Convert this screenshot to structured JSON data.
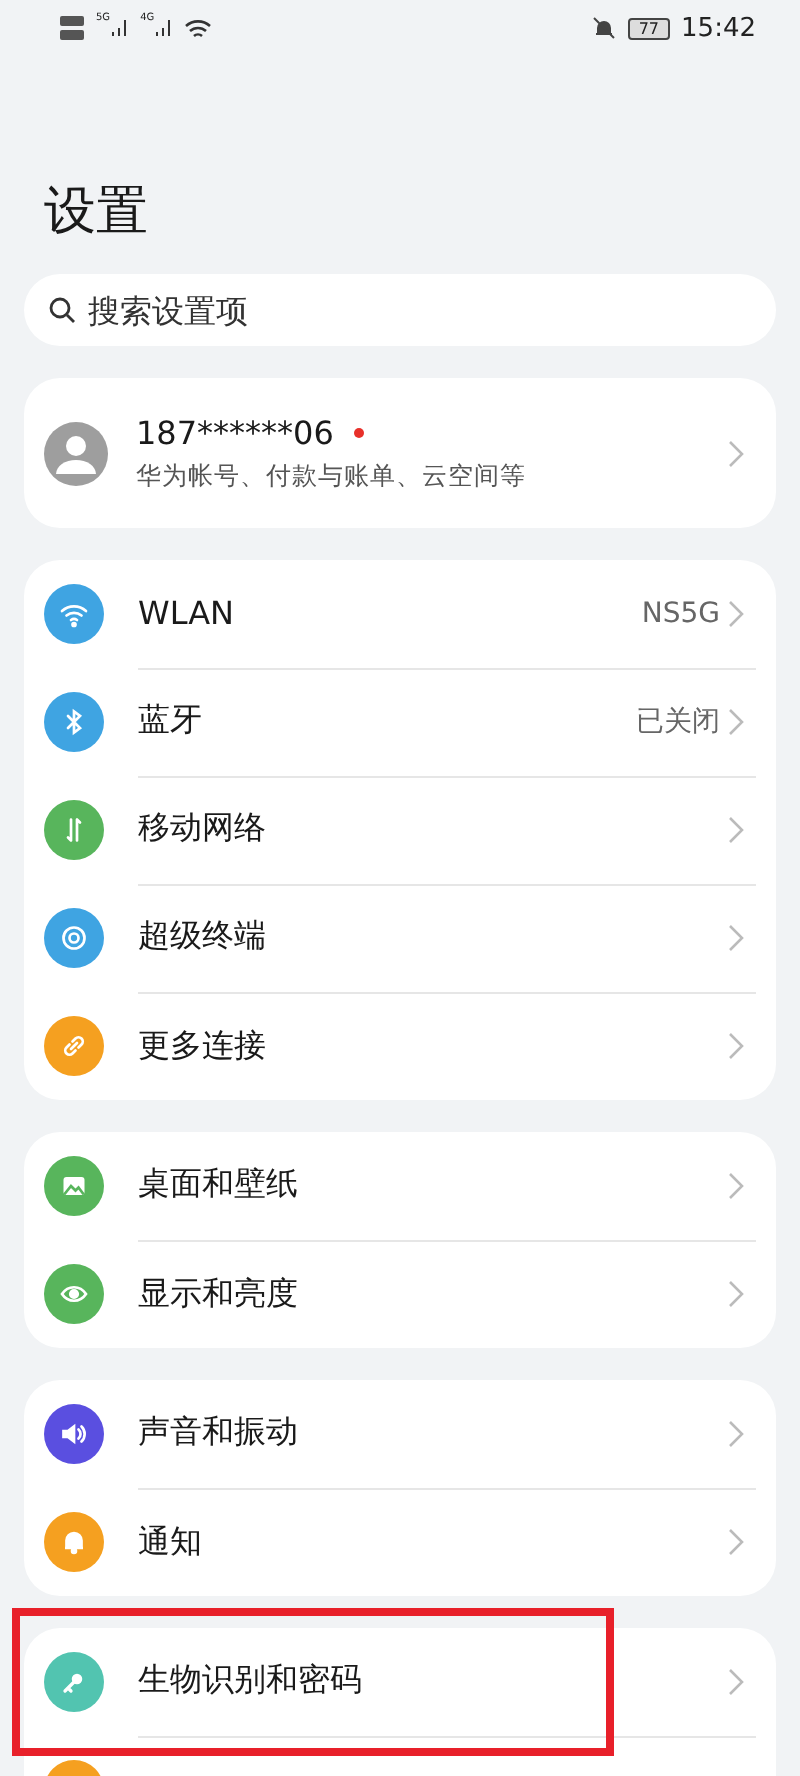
{
  "status_bar": {
    "sim_1_network": "5G",
    "sim_2_network": "4G",
    "battery": "77",
    "time": "15:42"
  },
  "title": "设置",
  "search": {
    "placeholder": "搜索设置项"
  },
  "account": {
    "name": "187******06",
    "unread": true,
    "subtitle": "华为帐号、付款与账单、云空间等"
  },
  "groups": [
    {
      "items": [
        {
          "kind": "wifi",
          "color": "#3fa4e2",
          "label": "WLAN",
          "value": "NS5G"
        },
        {
          "kind": "bluetooth",
          "color": "#3fa4e2",
          "label": "蓝牙",
          "value": "已关闭"
        },
        {
          "kind": "mobile",
          "color": "#58b55c",
          "label": "移动网络"
        },
        {
          "kind": "terminal",
          "color": "#3fa4e2",
          "label": "超级终端"
        },
        {
          "kind": "link",
          "color": "#f5a020",
          "label": "更多连接"
        }
      ]
    },
    {
      "items": [
        {
          "kind": "wallpaper",
          "color": "#58b55c",
          "label": "桌面和壁纸"
        },
        {
          "kind": "eye",
          "color": "#58b55c",
          "label": "显示和亮度"
        }
      ]
    },
    {
      "items": [
        {
          "kind": "sound",
          "color": "#5a4fe0",
          "label": "声音和振动"
        },
        {
          "kind": "bell",
          "color": "#f5a020",
          "label": "通知"
        }
      ]
    },
    {
      "items": [
        {
          "kind": "key",
          "color": "#52c4b0",
          "label": "生物识别和密码",
          "highlighted": true
        },
        {
          "kind": "cut",
          "color": "#f5a020"
        }
      ]
    }
  ]
}
